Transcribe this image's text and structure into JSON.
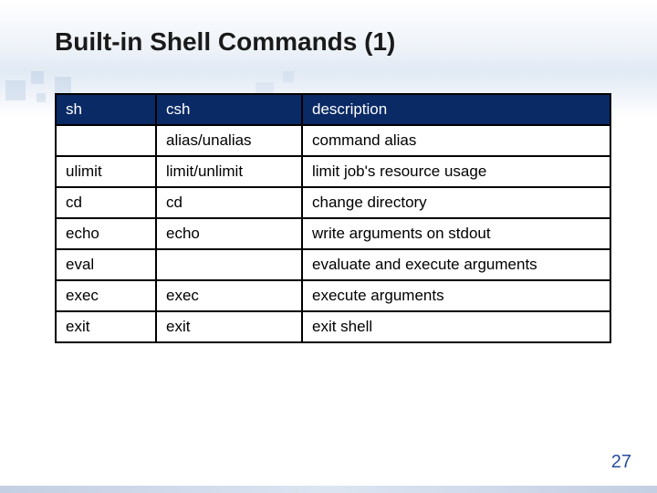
{
  "title": "Built-in Shell Commands (1)",
  "page_number": "27",
  "table": {
    "header": {
      "sh": "sh",
      "csh": "csh",
      "desc": "description"
    },
    "rows": [
      {
        "sh": "",
        "csh": "alias/unalias",
        "desc": "command alias"
      },
      {
        "sh": "ulimit",
        "csh": "limit/unlimit",
        "desc": "limit job's resource usage"
      },
      {
        "sh": "cd",
        "csh": "cd",
        "desc": "change directory"
      },
      {
        "sh": "echo",
        "csh": "echo",
        "desc": "write arguments on stdout"
      },
      {
        "sh": "eval",
        "csh": "",
        "desc": "evaluate and execute arguments"
      },
      {
        "sh": "exec",
        "csh": "exec",
        "desc": "execute arguments"
      },
      {
        "sh": "exit",
        "csh": "exit",
        "desc": "exit shell"
      }
    ]
  }
}
